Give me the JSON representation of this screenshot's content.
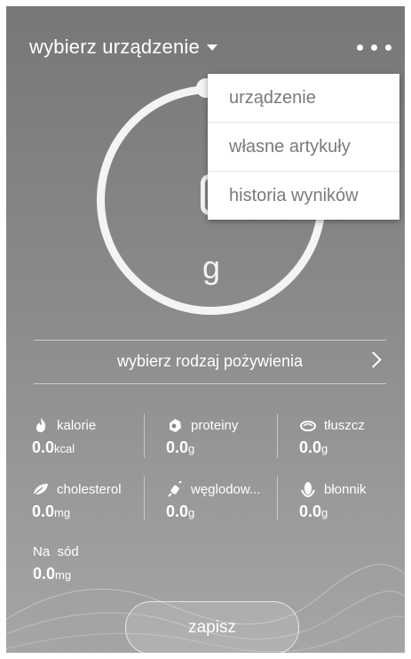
{
  "header": {
    "device_select": "wybierz urządzenie",
    "more_icon": "more-horizontal-icon"
  },
  "scale": {
    "unit": "g"
  },
  "menu": {
    "items": [
      "urządzenie",
      "własne artykuły",
      "historia wyników"
    ]
  },
  "food_type": {
    "label": "wybierz rodzaj pożywienia"
  },
  "nutrients": [
    {
      "name": "kalorie",
      "value": "0.0",
      "unit": "kcal",
      "icon": "flame-icon"
    },
    {
      "name": "proteiny",
      "value": "0.0",
      "unit": "g",
      "icon": "protein-icon"
    },
    {
      "name": "tłuszcz",
      "value": "0.0",
      "unit": "g",
      "icon": "fat-icon"
    },
    {
      "name": "cholesterol",
      "value": "0.0",
      "unit": "mg",
      "icon": "leaf-icon"
    },
    {
      "name": "węglodow...",
      "value": "0.0",
      "unit": "g",
      "icon": "carbs-icon"
    },
    {
      "name": "błonnik",
      "value": "0.0",
      "unit": "g",
      "icon": "fiber-icon"
    },
    {
      "name": "Na  sód",
      "value": "0.0",
      "unit": "mg",
      "icon": ""
    }
  ],
  "actions": {
    "save": "zapisz"
  }
}
